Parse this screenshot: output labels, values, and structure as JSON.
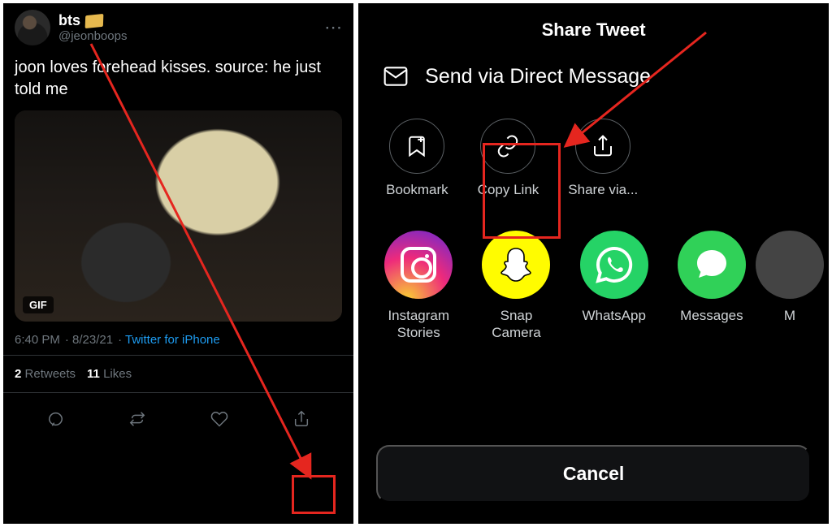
{
  "tweet": {
    "display_name": "bts",
    "username": "@jeonboops",
    "text": "joon loves forehead kisses. source: he just told me",
    "gif_badge": "GIF",
    "timestamp": "6:40 PM",
    "date": "8/23/21",
    "source": "Twitter for iPhone",
    "retweets_count": "2",
    "retweets_label": "Retweets",
    "likes_count": "11",
    "likes_label": "Likes"
  },
  "share": {
    "title": "Share Tweet",
    "dm_label": "Send via Direct Message",
    "options": {
      "bookmark": "Bookmark",
      "copy_link": "Copy Link",
      "share_via": "Share via..."
    },
    "externals": {
      "instagram": "Instagram Stories",
      "snapchat": "Snap Camera",
      "whatsapp": "WhatsApp",
      "messages": "Messages",
      "more_initial": "M"
    },
    "cancel": "Cancel"
  }
}
